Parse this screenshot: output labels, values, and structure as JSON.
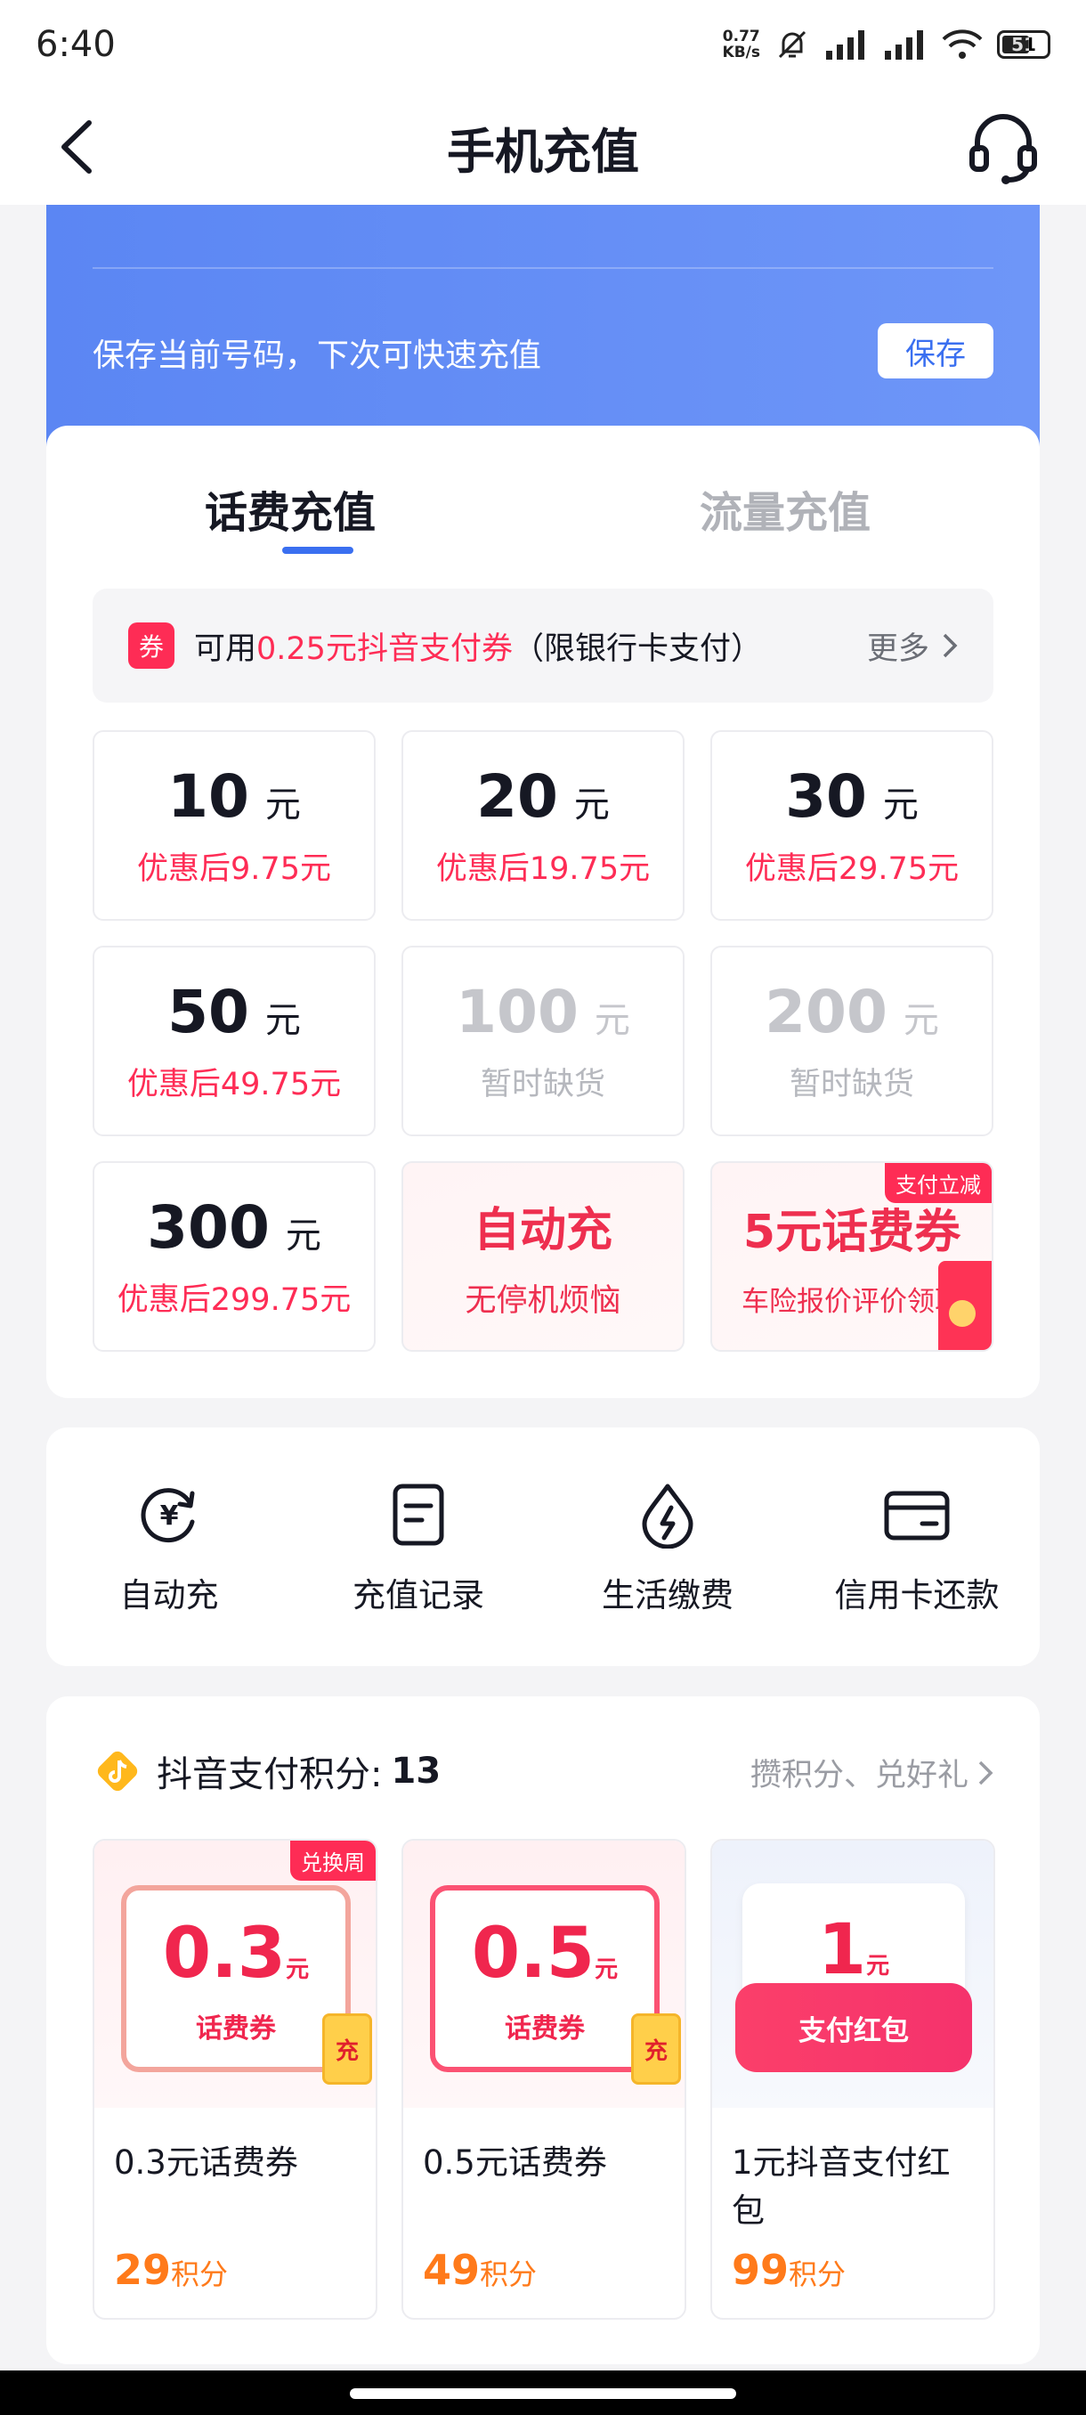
{
  "status_bar": {
    "time": "6:40",
    "net_speed_value": "0.77",
    "net_speed_unit": "KB/s",
    "battery": "51"
  },
  "nav": {
    "title": "手机充值"
  },
  "header": {
    "save_tip": "保存当前号码，下次可快速充值",
    "save_button": "保存"
  },
  "tabs": [
    {
      "label": "话费充值",
      "active": true
    },
    {
      "label": "流量充值",
      "active": false
    }
  ],
  "coupon_bar": {
    "tag": "券",
    "prefix": "可用",
    "highlight": "0.25元抖音支付券",
    "suffix": "（限银行卡支付）",
    "more": "更多"
  },
  "recharge_options": [
    {
      "amount": "10",
      "unit": "元",
      "sub": "优惠后9.75元",
      "available": true
    },
    {
      "amount": "20",
      "unit": "元",
      "sub": "优惠后19.75元",
      "available": true
    },
    {
      "amount": "30",
      "unit": "元",
      "sub": "优惠后29.75元",
      "available": true
    },
    {
      "amount": "50",
      "unit": "元",
      "sub": "优惠后49.75元",
      "available": true
    },
    {
      "amount": "100",
      "unit": "元",
      "sub": "暂时缺货",
      "available": false
    },
    {
      "amount": "200",
      "unit": "元",
      "sub": "暂时缺货",
      "available": false
    },
    {
      "amount": "300",
      "unit": "元",
      "sub": "优惠后299.75元",
      "available": true
    }
  ],
  "promo_tiles": [
    {
      "title": "自动充",
      "sub": "无停机烦恼"
    },
    {
      "title": "5元话费券",
      "sub": "车险报价评价领取",
      "badge": "支付立减"
    }
  ],
  "shortcuts": [
    {
      "label": "自动充",
      "icon": "auto-recharge-icon"
    },
    {
      "label": "充值记录",
      "icon": "record-icon"
    },
    {
      "label": "生活缴费",
      "icon": "utility-bill-icon"
    },
    {
      "label": "信用卡还款",
      "icon": "credit-card-icon"
    }
  ],
  "points": {
    "title": "抖音支付积分:",
    "count": "13",
    "link": "攒积分、兑好礼",
    "items": [
      {
        "value": "0.3",
        "unit": "元",
        "ribbon": "话费券",
        "stamp": "充",
        "name": "0.3元话费券",
        "points": "29",
        "points_unit": "积分",
        "tag": "兑换周"
      },
      {
        "value": "0.5",
        "unit": "元",
        "ribbon": "话费券",
        "stamp": "充",
        "name": "0.5元话费券",
        "points": "49",
        "points_unit": "积分"
      },
      {
        "value": "1",
        "unit": "元",
        "ribbon": "支付红包",
        "name": "1元抖音支付红包",
        "points": "99",
        "points_unit": "积分"
      }
    ]
  },
  "colors": {
    "accent_red": "#fe2c55",
    "accent_blue": "#3a6ff0",
    "points_orange": "#ff7a1a"
  }
}
